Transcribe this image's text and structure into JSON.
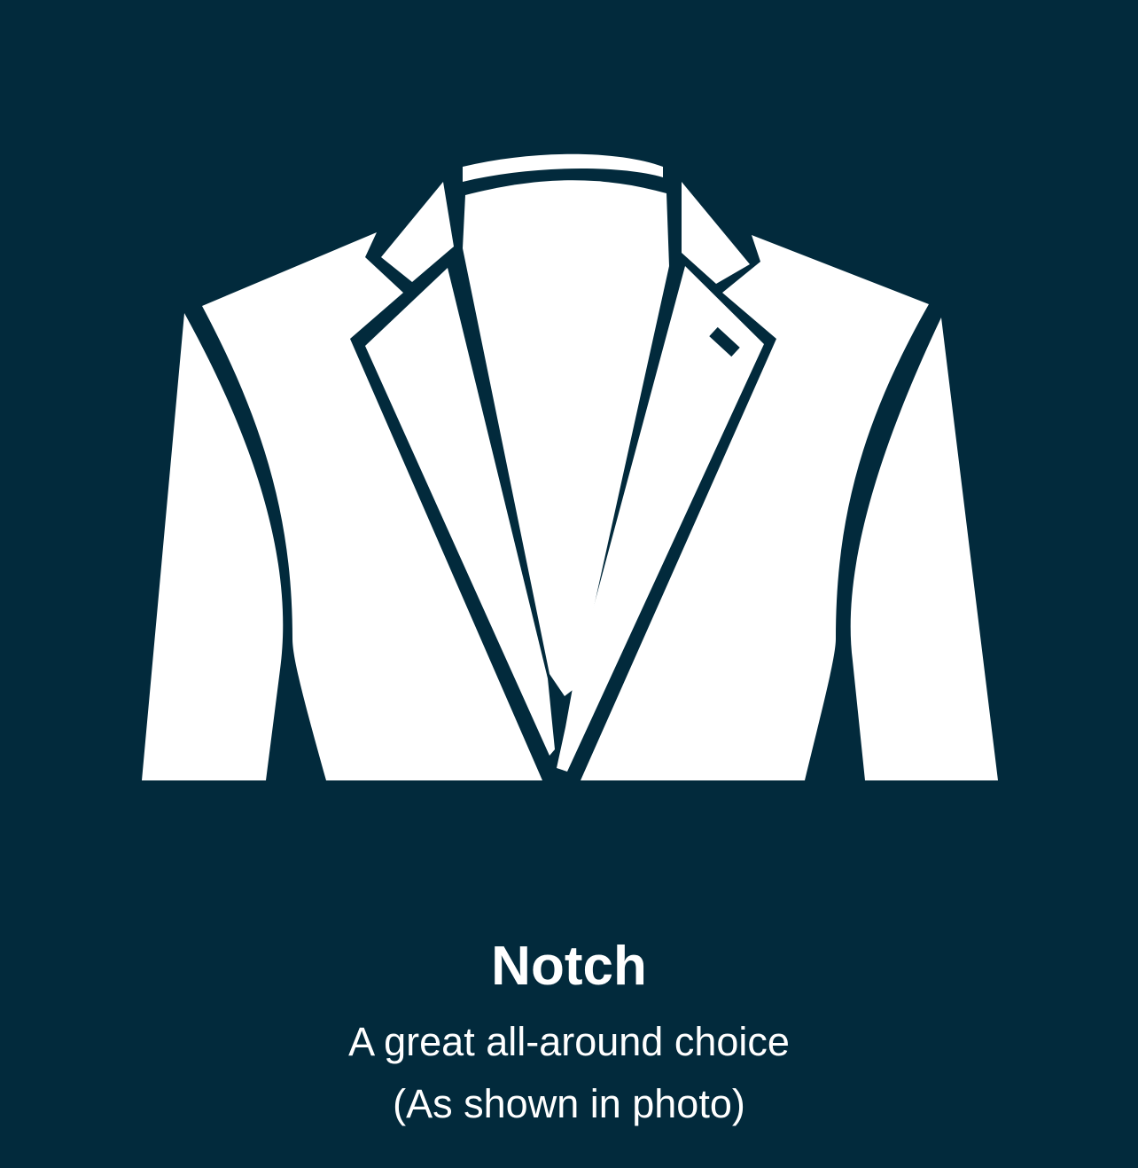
{
  "option": {
    "icon": "notch-lapel-jacket-icon",
    "title": "Notch",
    "description": "A great all-around choice",
    "note": "(As shown in photo)"
  },
  "colors": {
    "background": "#022a3c",
    "foreground": "#ffffff"
  }
}
